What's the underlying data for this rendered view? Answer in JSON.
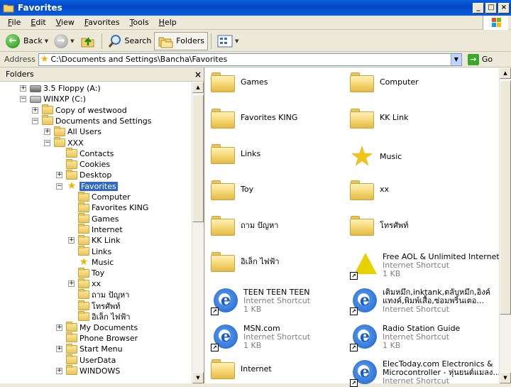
{
  "window": {
    "title": "Favorites"
  },
  "menu": [
    {
      "label": "File",
      "u": "F",
      "rest": "ile"
    },
    {
      "label": "Edit",
      "u": "E",
      "rest": "dit"
    },
    {
      "label": "View",
      "u": "V",
      "rest": "iew"
    },
    {
      "label": "Favorites",
      "u": "F",
      "rest": "avorites",
      "pre": ""
    },
    {
      "label": "Tools",
      "u": "T",
      "rest": "ools"
    },
    {
      "label": "Help",
      "u": "H",
      "rest": "elp"
    }
  ],
  "toolbar": {
    "back_label": "Back",
    "search_label": "Search",
    "folders_label": "Folders"
  },
  "address": {
    "label": "Address",
    "value": "C:\\Documents and Settings\\Bancha\\Favorites",
    "go_label": "Go"
  },
  "folders_pane": {
    "header": "Folders",
    "tree": [
      {
        "label": "3.5 Floppy (A:)",
        "indent": 0,
        "toggle": "+",
        "icon": "floppy"
      },
      {
        "label": "WINXP (C:)",
        "indent": 0,
        "toggle": "-",
        "icon": "drive"
      },
      {
        "label": "Copy of westwood",
        "indent": 1,
        "toggle": "+",
        "icon": "folder"
      },
      {
        "label": "Documents and Settings",
        "indent": 1,
        "toggle": "-",
        "icon": "folder"
      },
      {
        "label": "All Users",
        "indent": 2,
        "toggle": "+",
        "icon": "folder"
      },
      {
        "label": "XXX",
        "indent": 2,
        "toggle": "-",
        "icon": "folder"
      },
      {
        "label": "Contacts",
        "indent": 3,
        "toggle": "",
        "icon": "folder"
      },
      {
        "label": "Cookies",
        "indent": 3,
        "toggle": "",
        "icon": "folder"
      },
      {
        "label": "Desktop",
        "indent": 3,
        "toggle": "+",
        "icon": "folder"
      },
      {
        "label": "Favorites",
        "indent": 3,
        "toggle": "-",
        "icon": "star",
        "selected": true
      },
      {
        "label": "Computer",
        "indent": 4,
        "toggle": "",
        "icon": "folder"
      },
      {
        "label": "Favorites KING",
        "indent": 4,
        "toggle": "",
        "icon": "folder"
      },
      {
        "label": "Games",
        "indent": 4,
        "toggle": "",
        "icon": "folder"
      },
      {
        "label": "Internet",
        "indent": 4,
        "toggle": "",
        "icon": "folder"
      },
      {
        "label": "KK Link",
        "indent": 4,
        "toggle": "+",
        "icon": "folder"
      },
      {
        "label": "Links",
        "indent": 4,
        "toggle": "",
        "icon": "folder"
      },
      {
        "label": "Music",
        "indent": 4,
        "toggle": "",
        "icon": "star"
      },
      {
        "label": "Toy",
        "indent": 4,
        "toggle": "",
        "icon": "folder"
      },
      {
        "label": "xx",
        "indent": 4,
        "toggle": "+",
        "icon": "folder"
      },
      {
        "label": "ถาม ปัญหา",
        "indent": 4,
        "toggle": "",
        "icon": "folder"
      },
      {
        "label": "โทรศัพท์",
        "indent": 4,
        "toggle": "",
        "icon": "folder"
      },
      {
        "label": "อิเล็ก ไฟฟ้า",
        "indent": 4,
        "toggle": "",
        "icon": "folder"
      },
      {
        "label": "My Documents",
        "indent": 3,
        "toggle": "+",
        "icon": "folder"
      },
      {
        "label": "Phone Browser",
        "indent": 3,
        "toggle": "",
        "icon": "folder"
      },
      {
        "label": "Start Menu",
        "indent": 3,
        "toggle": "+",
        "icon": "folder"
      },
      {
        "label": "UserData",
        "indent": 3,
        "toggle": "",
        "icon": "folder"
      },
      {
        "label": "WINDOWS",
        "indent": 3,
        "toggle": "+",
        "icon": "folder"
      }
    ]
  },
  "items": [
    {
      "label": "Games",
      "icon": "folder"
    },
    {
      "label": "Computer",
      "icon": "folder"
    },
    {
      "label": "Favorites KING",
      "icon": "folder"
    },
    {
      "label": "KK Link",
      "icon": "folder"
    },
    {
      "label": "Links",
      "icon": "folder"
    },
    {
      "label": "Music",
      "icon": "star"
    },
    {
      "label": "Toy",
      "icon": "folder"
    },
    {
      "label": "xx",
      "icon": "folder"
    },
    {
      "label": "ถาม ปัญหา",
      "icon": "folder"
    },
    {
      "label": "โทรศัพท์",
      "icon": "folder"
    },
    {
      "label": "อิเล็ก ไฟฟ้า",
      "icon": "folder"
    },
    {
      "label": "Free AOL & Unlimited Internet",
      "icon": "aol",
      "type": "Internet Shortcut",
      "size": "1 KB"
    },
    {
      "label": "TEEN TEEN TEEN",
      "icon": "ie",
      "type": "Internet Shortcut",
      "size": "1 KB"
    },
    {
      "label": "เติมหมึก,inktank,ตลับหมึก,อิงค์แทงค์,พิมพ์เสื้อ,ซ่อมพริ้นเตอ...",
      "label2": "",
      "icon": "ie",
      "type": "Internet Shortcut",
      "size": ""
    },
    {
      "label": "MSN.com",
      "icon": "ie",
      "type": "Internet Shortcut",
      "size": "1 KB"
    },
    {
      "label": "Radio Station Guide",
      "icon": "ie",
      "type": "Internet Shortcut",
      "size": "1 KB"
    },
    {
      "label": "Internet",
      "icon": "folder"
    },
    {
      "label": "ElecToday.com  Electronics & Microcontroller - หุ่นยนต์แมลง...",
      "icon": "ie",
      "type": "Internet Shortcut",
      "size": ""
    }
  ],
  "item_lines": {
    "thai_ink_line1": "เติมหมึก,inktank,ตลับหมึก,อิงค์",
    "thai_ink_line2": "แทงค์,พิมพ์เสื้อ,ซ่อมพริ้นเตอ...",
    "elec_line1": "ElecToday.com  Electronics &",
    "elec_line2": "Microcontroller - หุ่นยนต์แมลง..."
  }
}
